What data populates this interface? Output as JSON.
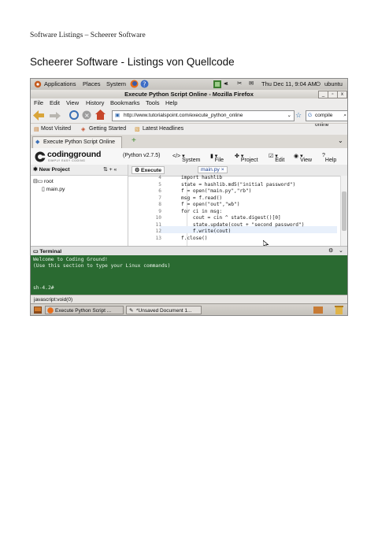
{
  "page": {
    "header": "Software Listings – Scheerer Software",
    "title": "Scheerer Software - Listings von Quellcode"
  },
  "gnome_panel": {
    "applications": "Applications",
    "places": "Places",
    "system": "System",
    "datetime": "Thu Dec 11,  9:04 AM",
    "user": "ubuntu"
  },
  "window": {
    "title": "Execute Python Script Online - Mozilla Firefox",
    "buttons": [
      "_",
      "▫",
      "x"
    ]
  },
  "menu": [
    "File",
    "Edit",
    "View",
    "History",
    "Bookmarks",
    "Tools",
    "Help"
  ],
  "nav": {
    "url": "http://www.tutorialspoint.com/execute_python_online",
    "search": "compile online"
  },
  "bookmarks": [
    "Most Visited",
    "Getting Started",
    "Latest Headlines"
  ],
  "tab": {
    "label": "Execute Python Script Online",
    "new_tab": "+"
  },
  "codingground": {
    "logo": "codingground",
    "tagline": "SIMPLY EASY CODING",
    "version": "(Python v2.7.5)",
    "menu": [
      "System",
      "File",
      "Project",
      "Edit",
      "View",
      "Help"
    ]
  },
  "project": {
    "new_project": "New Project",
    "tools": "⇅ + «",
    "root": "root",
    "file": "main.py"
  },
  "editor": {
    "execute": "Execute",
    "file_tab": "main.py",
    "line_numbers": [
      "4",
      "5",
      "6",
      "7",
      "8",
      "9",
      "10",
      "11",
      "12",
      "13"
    ],
    "lines": [
      "import hashlib",
      "state = hashlib.md5(\"initial password\")",
      "f = open(\"main.py\",\"rb\")",
      "msg = f.read()",
      "f = open(\"out\",\"wb\")",
      "for ci in msg:",
      "    cout = cin ^ state.digest()[0]",
      "    state.update(cout + \"second password\")",
      "    f.write(cout)",
      "f.close()"
    ]
  },
  "terminal": {
    "label": "Terminal",
    "lines": [
      "Welcome to Coding Ground!",
      "(Use this section to type your Linux commands)",
      "",
      "",
      "sh-4.2#"
    ]
  },
  "statusbar": "javascript:void(0)",
  "taskbar": [
    "Execute Python Script ...",
    "*Unsaved Document 1..."
  ]
}
